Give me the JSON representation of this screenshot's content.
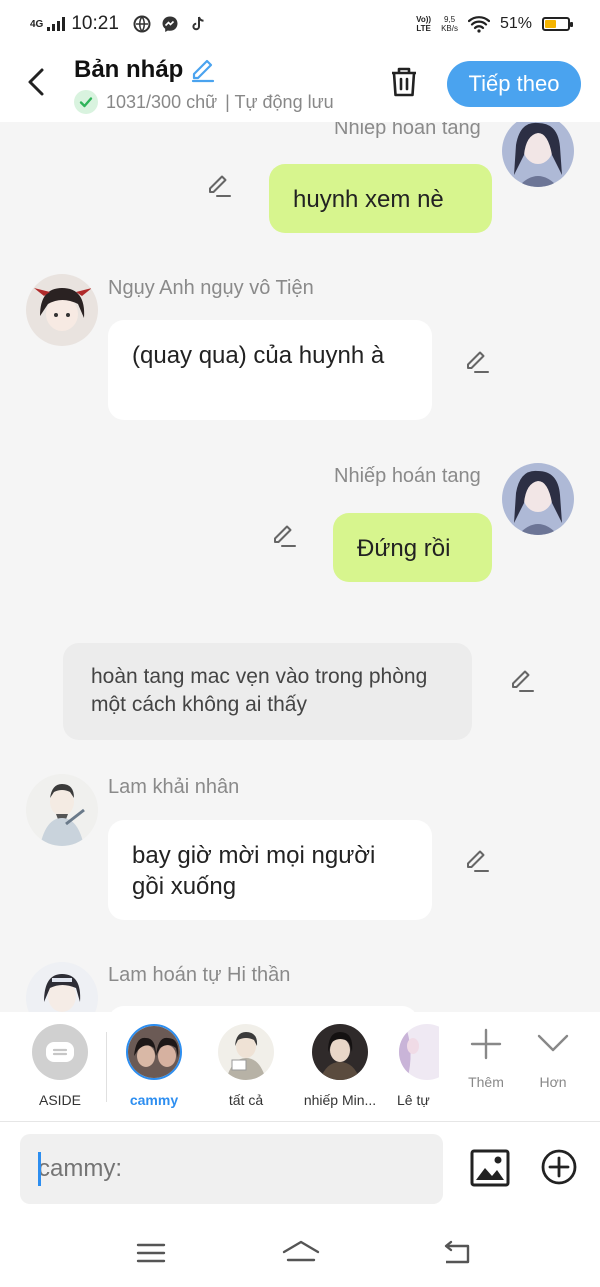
{
  "status": {
    "network": "4G",
    "time": "10:21",
    "volte": "Vo)) LTE",
    "speed_value": "9,5",
    "speed_unit": "KB/s",
    "battery": "51%",
    "battery_level": 0.51
  },
  "header": {
    "title": "Bản nháp",
    "word_count": "1031/300 chữ",
    "autosave": "| Tự động lưu",
    "next_button": "Tiếp theo"
  },
  "chat": {
    "top_name": "Nhiếp hoán tang",
    "messages": [
      {
        "speaker": "",
        "text": "huynh xem nè",
        "side": "right"
      },
      {
        "speaker": "Ngụy Anh ngụy vô Tiện",
        "text": "(quay qua) của huynh à",
        "side": "left"
      },
      {
        "speaker": "Nhiếp hoán tang",
        "text": "Đứng rồi",
        "side": "right"
      },
      {
        "speaker": "",
        "text": "hoàn tang mac vẹn vào trong phòng một cách không ai thấy",
        "side": "aside"
      },
      {
        "speaker": "Lam khải nhân",
        "text": "bay giờ mời mọi người gồi xuống",
        "side": "left"
      },
      {
        "speaker": "Lam hoán tự Hi thần",
        "text": "",
        "side": "left"
      }
    ]
  },
  "characters": [
    {
      "label": "ASIDE"
    },
    {
      "label": "cammy"
    },
    {
      "label": "tất cả"
    },
    {
      "label": "nhiếp Min..."
    },
    {
      "label": "Lê tự"
    }
  ],
  "tools": {
    "add_label": "Thêm",
    "more_label": "Hơn"
  },
  "input": {
    "placeholder": "cammy:"
  },
  "colors": {
    "accent": "#4aa3ef",
    "green_bubble": "#d7f58e",
    "active_blue": "#2d8ef0"
  }
}
